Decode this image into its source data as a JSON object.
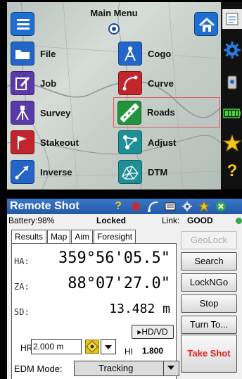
{
  "main_menu": {
    "title": "Main Menu",
    "items": [
      {
        "label": "File",
        "icon": "folder-icon"
      },
      {
        "label": "Cogo",
        "icon": "compass-icon"
      },
      {
        "label": "Job",
        "icon": "job-edit-icon"
      },
      {
        "label": "Curve",
        "icon": "curve-icon"
      },
      {
        "label": "Survey",
        "icon": "tripod-icon"
      },
      {
        "label": "Roads",
        "icon": "road-icon"
      },
      {
        "label": "Stakeout",
        "icon": "flag-icon"
      },
      {
        "label": "Adjust",
        "icon": "network-icon"
      },
      {
        "label": "Inverse",
        "icon": "inverse-arrow-icon"
      },
      {
        "label": "DTM",
        "icon": "dtm-mesh-icon"
      }
    ],
    "selected": "Roads"
  },
  "remote_shot": {
    "title": "Remote Shot",
    "battery": "Battery:98%",
    "lock_status": "Locked",
    "link_label": "Link:",
    "link_value": "GOOD",
    "tabs": [
      "Results",
      "Map",
      "Aim",
      "Foresight"
    ],
    "active_tab": "Results",
    "ha_label": "HA:",
    "ha_value": "359°56'05.5\"",
    "za_label": "ZA:",
    "za_value": "88°07'27.0\"",
    "sd_label": "SD:",
    "sd_value": "13.482 m",
    "hdvd_button": "▸HD/VD",
    "hr_label": "HR",
    "hr_value": "2.000 m",
    "hi_label": "HI",
    "hi_value": "1.800",
    "edm_label": "EDM Mode:",
    "edm_value": "Tracking",
    "buttons": {
      "geolock": "GeoLock",
      "search": "Search",
      "lockngo": "LockNGo",
      "stop": "Stop",
      "turn_to": "Turn To...",
      "take_shot": "Take Shot"
    }
  },
  "colors": {
    "titlebar": "#2f6bbf",
    "take_shot_text": "#e02020",
    "menu_blue": "#2365c8"
  }
}
